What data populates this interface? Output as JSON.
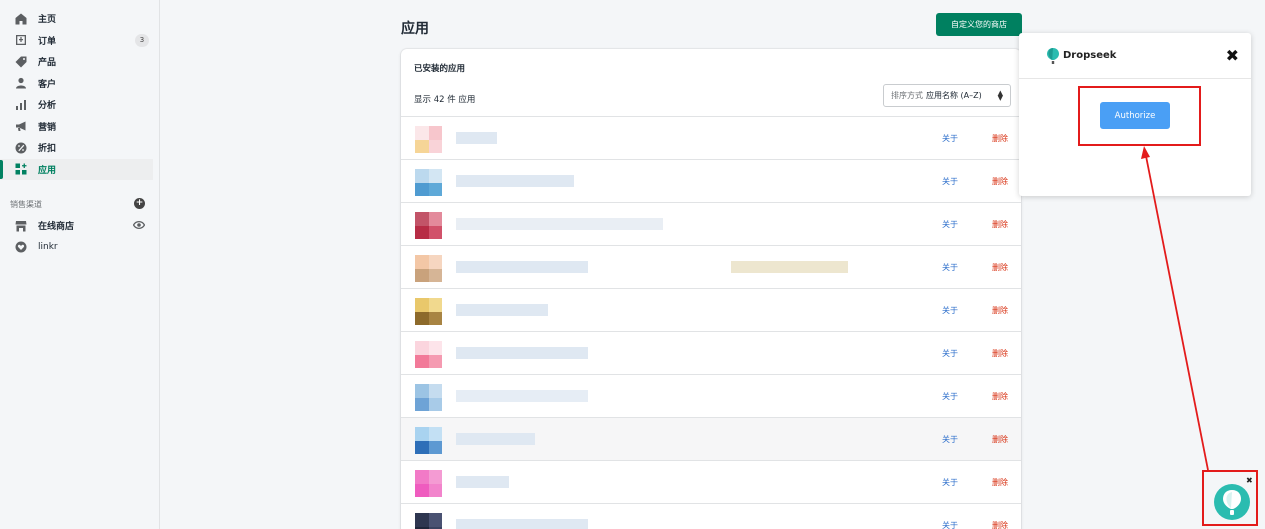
{
  "sidebar": {
    "items": [
      {
        "label": "主页",
        "icon": "home-icon"
      },
      {
        "label": "订单",
        "icon": "orders-icon",
        "badge": "3"
      },
      {
        "label": "产品",
        "icon": "tag-icon"
      },
      {
        "label": "客户",
        "icon": "person-icon"
      },
      {
        "label": "分析",
        "icon": "bar-chart-icon"
      },
      {
        "label": "营销",
        "icon": "megaphone-icon"
      },
      {
        "label": "折扣",
        "icon": "discount-icon"
      },
      {
        "label": "应用",
        "icon": "apps-icon",
        "active": true
      }
    ],
    "channels_heading": "销售渠道",
    "channels": [
      {
        "label": "在线商店",
        "icon": "store-icon"
      },
      {
        "label": "linkr",
        "icon": "heart-icon"
      }
    ]
  },
  "main": {
    "title": "应用",
    "customize_button": "自定义您的商店",
    "card_title": "已安装的应用",
    "count_text": "显示 42 件 应用",
    "sort_prefix": "排序方式",
    "sort_value": "应用名称 (A–Z)",
    "about_label": "关于",
    "delete_label": "删除"
  },
  "popup": {
    "brand": "Dropseek",
    "close": "✖",
    "authorize": "Authorize"
  },
  "widget": {
    "close": "✖"
  },
  "colors": {
    "accent": "#008060",
    "link": "#2c6ecb",
    "danger": "#d72c0d",
    "authorize": "#4a9ff5",
    "annotation": "#e31b1b"
  }
}
